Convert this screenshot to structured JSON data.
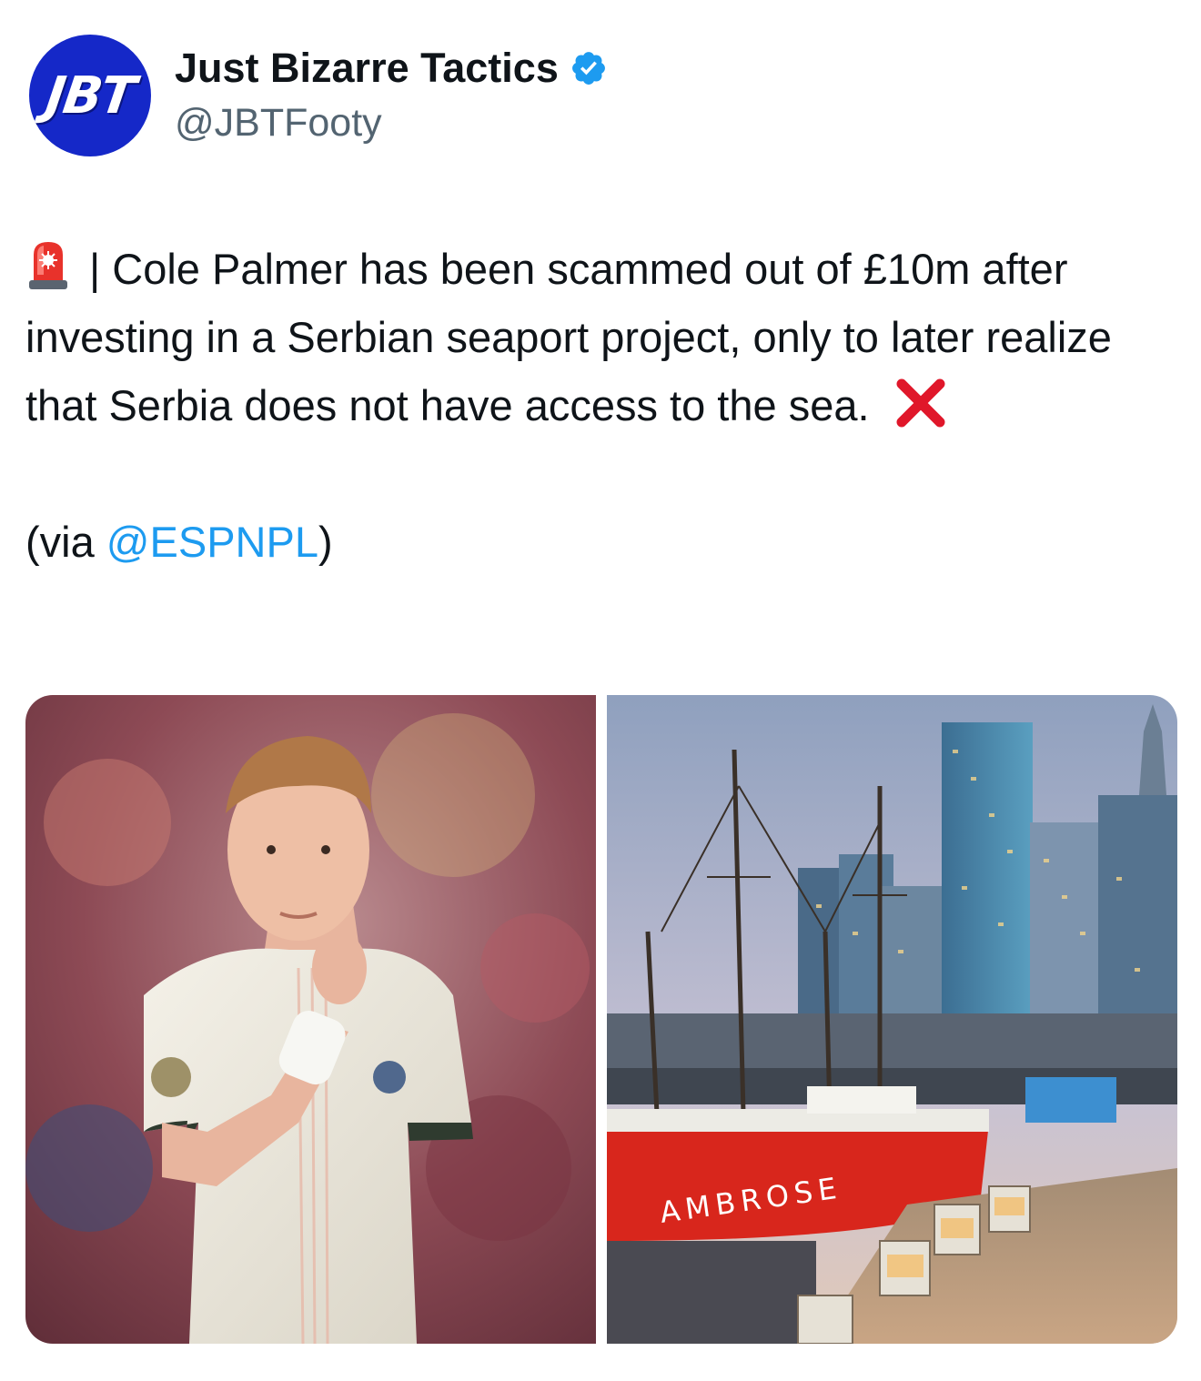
{
  "author": {
    "avatar_text": "JBT",
    "display_name": "Just Bizarre Tactics",
    "handle": "@JBTFooty",
    "verified_icon": "verified-badge-icon"
  },
  "tweet": {
    "line_main": "| Cole Palmer has been scammed out of £10m after investing in a Serbian seaport project, only to later realize that Serbia does not have access to the sea.",
    "via_prefix": "(via ",
    "via_mention": "@ESPNPL",
    "via_suffix": ")",
    "emoji_start": "rotating-light-icon",
    "emoji_end": "cross-mark-icon"
  },
  "media": {
    "left_photo": "footballer-photo",
    "right_photo": "seaport-photo",
    "ship_lettering": "AMBROSE"
  },
  "colors": {
    "link": "#1d9bf0",
    "avatar_bg": "#1528c8",
    "verified": "#1d9bf0",
    "ship_hull": "#d8261c"
  }
}
